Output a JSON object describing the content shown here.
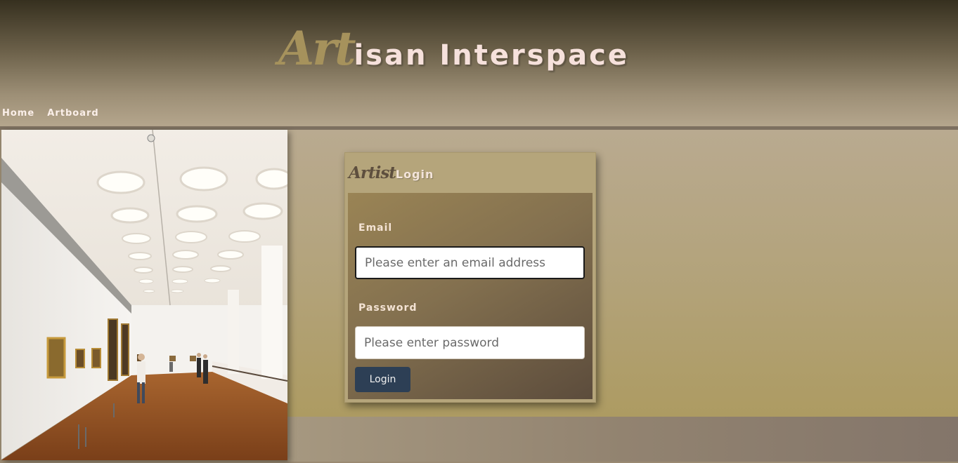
{
  "brand": {
    "prefix": "Art",
    "rest": "isan Interspace"
  },
  "nav": {
    "items": [
      {
        "label": "Home"
      },
      {
        "label": "Artboard"
      }
    ]
  },
  "login": {
    "title_prefix": "Artist",
    "title": "Login",
    "email_label": "Email",
    "email_placeholder": "Please enter an email address",
    "password_label": "Password",
    "password_placeholder": "Please enter password",
    "submit_label": "Login"
  },
  "colors": {
    "header_top": "#36301f",
    "accent_gold": "#a6925c",
    "button": "#2d3f55",
    "card": "#b5a57b"
  }
}
